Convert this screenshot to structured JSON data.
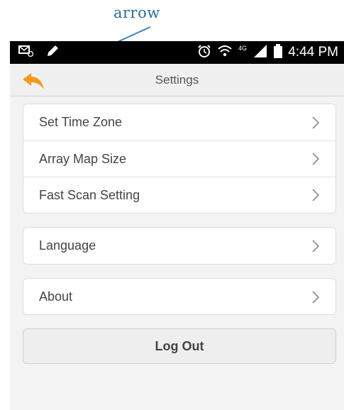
{
  "annotation": {
    "label": "arrow",
    "color": "#2b6a9c"
  },
  "status_bar": {
    "time": "4:44 PM",
    "network_label": "4G",
    "icons": [
      "mail-icon",
      "pen-icon",
      "alarm-icon",
      "wifi-icon",
      "signal-icon",
      "battery-icon"
    ]
  },
  "header": {
    "title": "Settings",
    "back_icon": "back-arrow-icon",
    "accent_color": "#f39a1e"
  },
  "settings": {
    "group_main": [
      {
        "label": "Set Time Zone"
      },
      {
        "label": "Array Map Size"
      },
      {
        "label": "Fast Scan Setting"
      }
    ],
    "language": {
      "label": "Language"
    },
    "about": {
      "label": "About"
    }
  },
  "logout": {
    "label": "Log Out"
  }
}
